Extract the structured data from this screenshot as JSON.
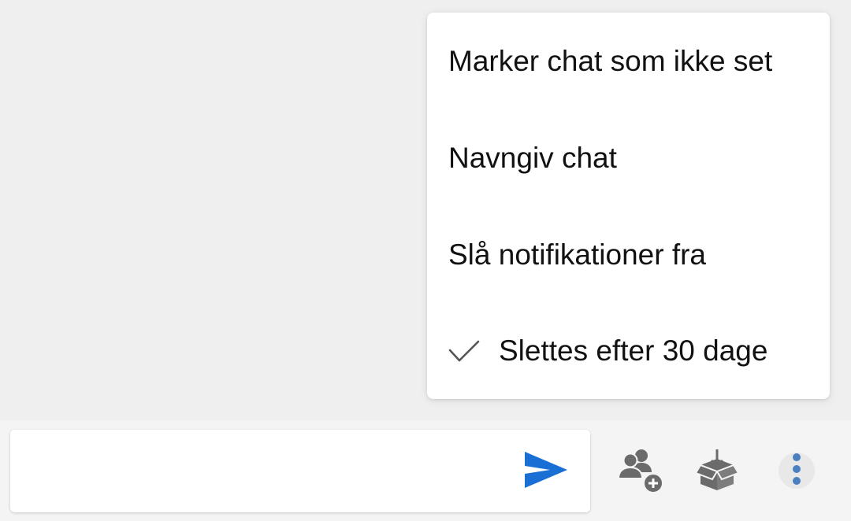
{
  "menu": {
    "items": [
      {
        "label": "Marker chat som ikke set",
        "checked": false
      },
      {
        "label": "Navngiv chat",
        "checked": false
      },
      {
        "label": "Slå notifikationer fra",
        "checked": false
      },
      {
        "label": "Slettes efter 30 dage",
        "checked": true
      }
    ]
  },
  "composer": {
    "message_value": "",
    "send_icon": "send-icon"
  },
  "toolbar": {
    "icons": [
      "add-people-icon",
      "archive-box-icon",
      "more-vertical-icon"
    ]
  },
  "colors": {
    "accent": "#1a6fd4",
    "icon_gray": "#6b6b6b",
    "more_dots": "#4a7fc0"
  }
}
